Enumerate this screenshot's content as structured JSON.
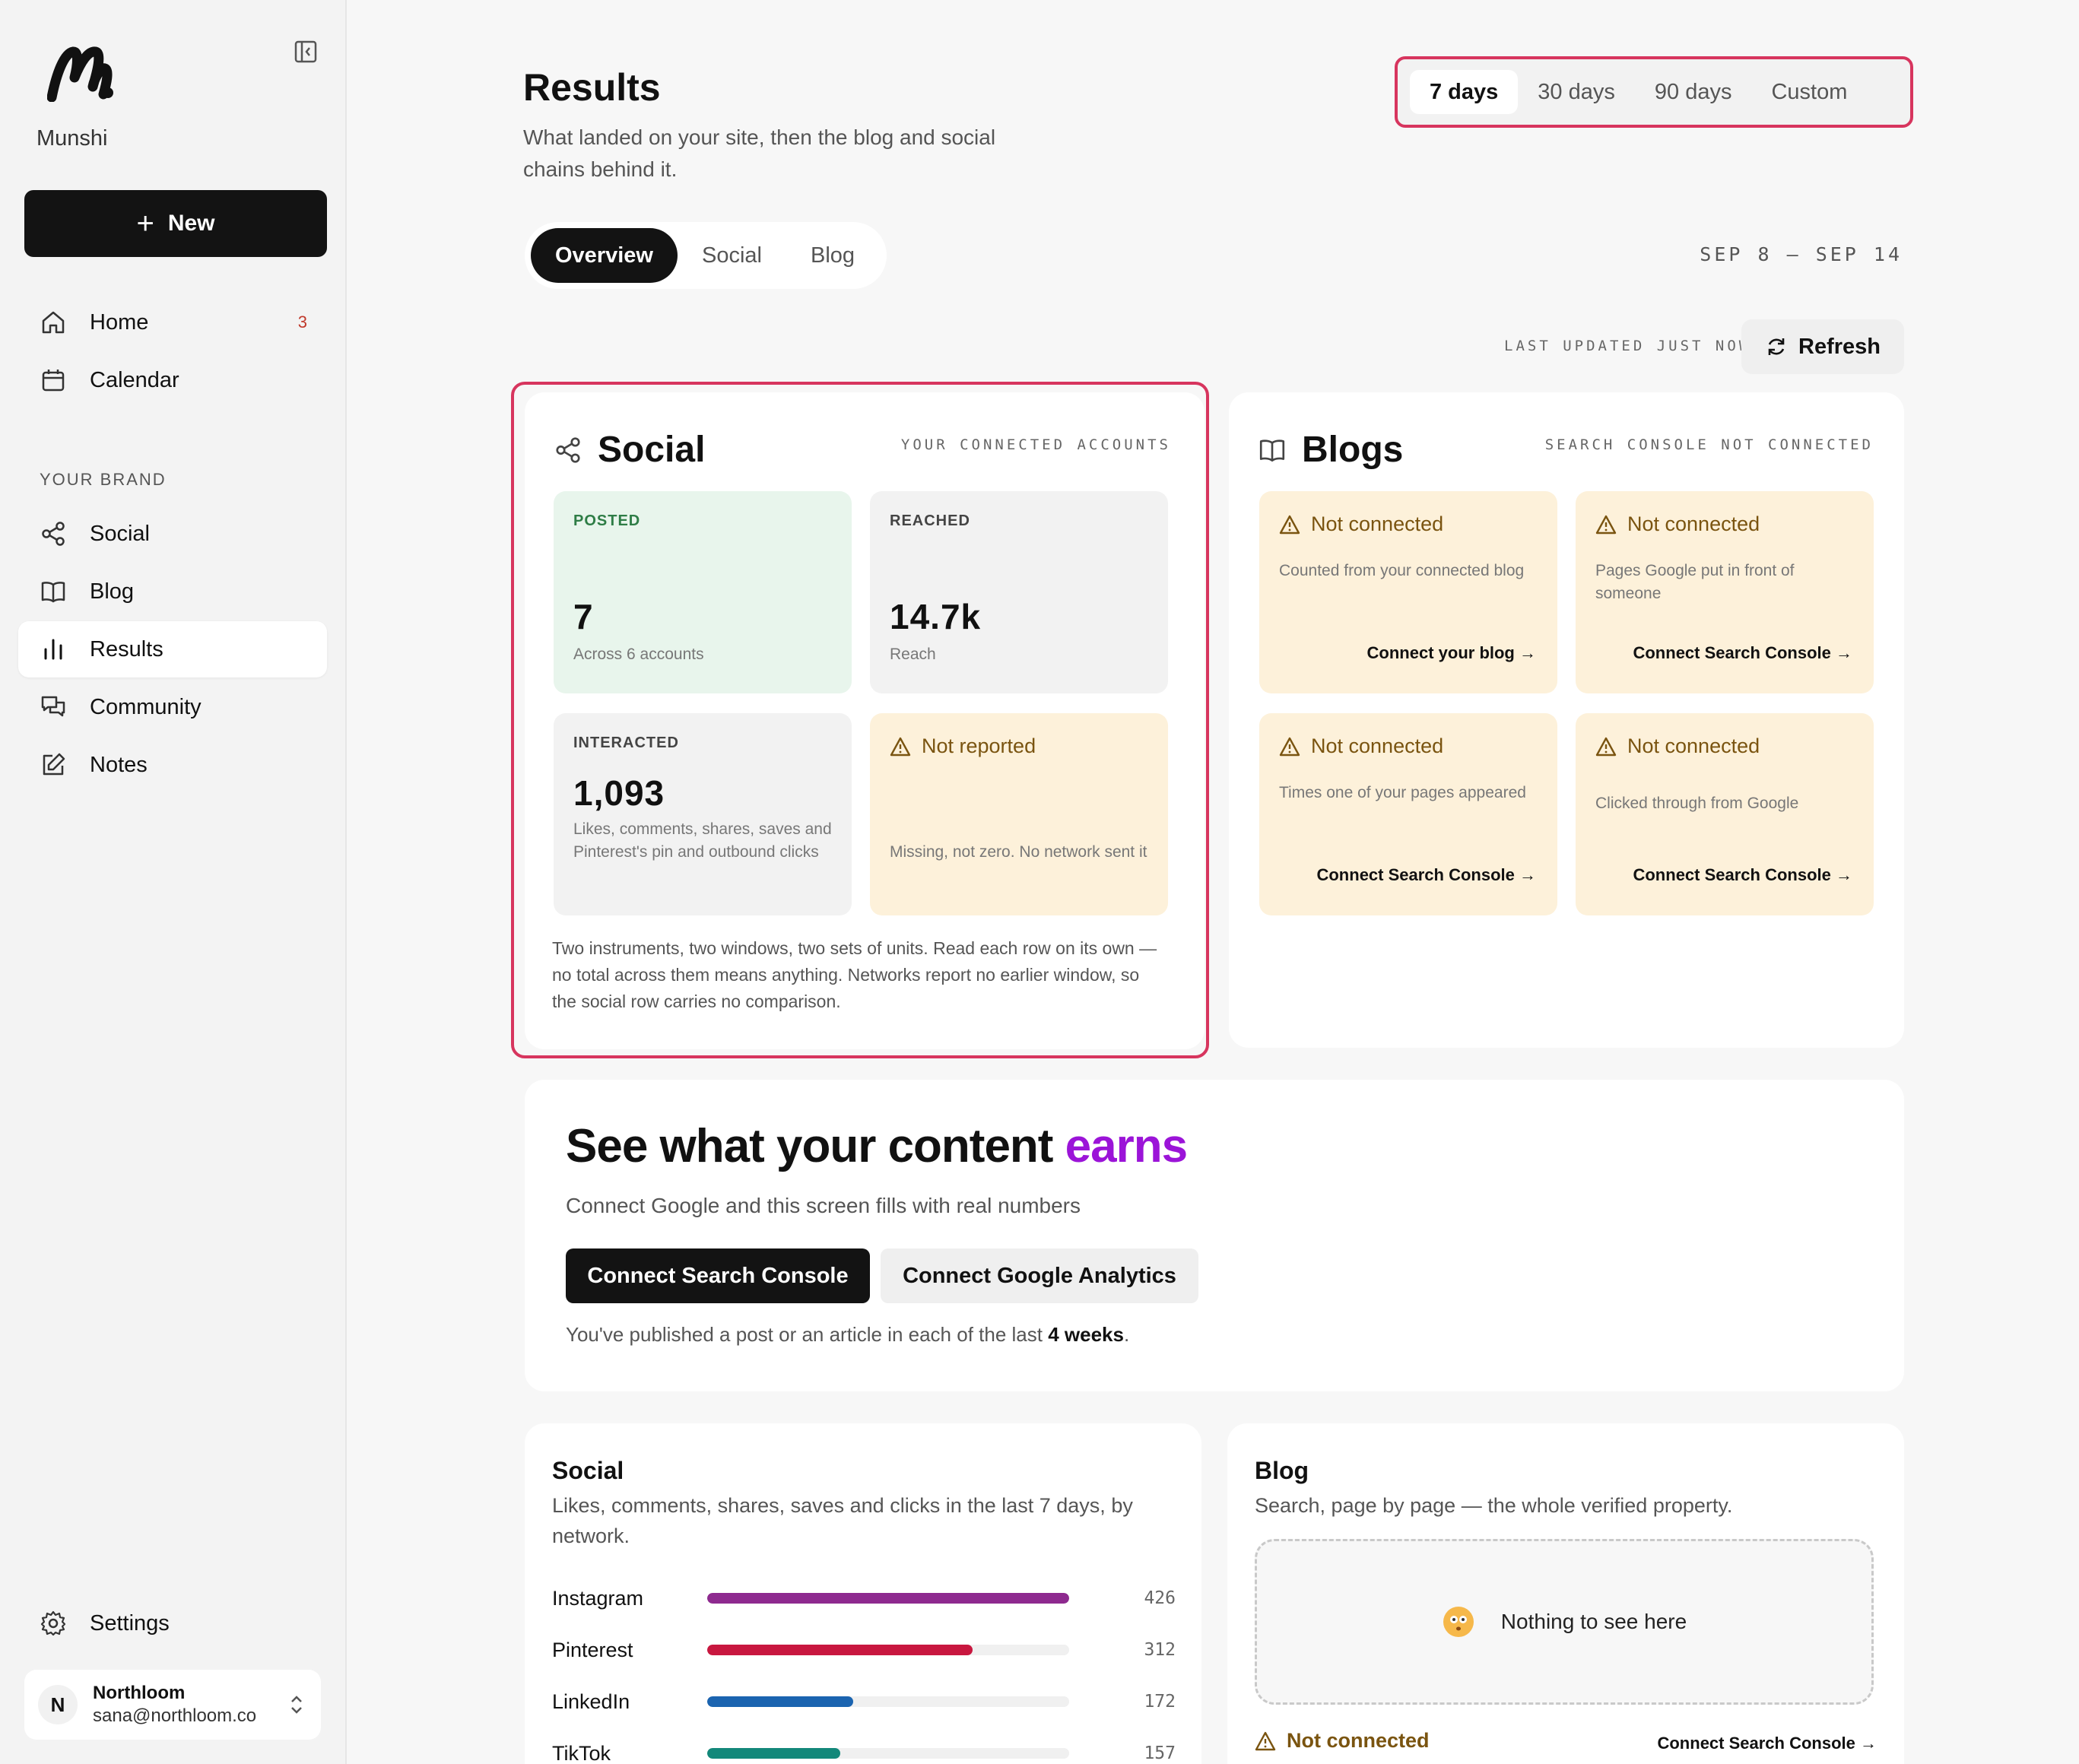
{
  "sidebar": {
    "brand": "Munshi",
    "new_label": "New",
    "nav": [
      {
        "label": "Home",
        "badge": "3"
      },
      {
        "label": "Calendar"
      }
    ],
    "section_label": "YOUR BRAND",
    "brand_nav": [
      {
        "label": "Social"
      },
      {
        "label": "Blog"
      },
      {
        "label": "Results",
        "active": true
      },
      {
        "label": "Community"
      },
      {
        "label": "Notes"
      }
    ],
    "settings_label": "Settings",
    "account": {
      "initial": "N",
      "name": "Northloom",
      "email": "sana@northloom.co"
    }
  },
  "header": {
    "title": "Results",
    "subtitle": "What landed on your site, then the blog and social chains behind it.",
    "ranges": [
      "7 days",
      "30 days",
      "90 days",
      "Custom"
    ],
    "active_range": "7 days",
    "tabs": [
      "Overview",
      "Social",
      "Blog"
    ],
    "active_tab": "Overview",
    "date_range": "SEP 8 – SEP 14",
    "updated": "LAST UPDATED JUST NOW",
    "refresh_label": "Refresh"
  },
  "social_card": {
    "title": "Social",
    "caption": "YOUR CONNECTED ACCOUNTS",
    "posted": {
      "label": "POSTED",
      "value": "7",
      "note": "Across 6 accounts"
    },
    "reached": {
      "label": "REACHED",
      "value": "14.7k",
      "note": "Reach"
    },
    "interacted": {
      "label": "INTERACTED",
      "value": "1,093",
      "note": "Likes, comments, shares, saves and Pinterest's pin and outbound clicks"
    },
    "not_reported": {
      "label": "Not reported",
      "note": "Missing, not zero. No network sent it"
    },
    "footnote": "Two instruments, two windows, two sets of units. Read each row on its own — no total across them means anything. Networks report no earlier window, so the social row carries no comparison."
  },
  "blogs_card": {
    "title": "Blogs",
    "caption": "SEARCH CONSOLE NOT CONNECTED",
    "tiles": [
      {
        "status": "Not connected",
        "note": "Counted from your connected blog",
        "cta": "Connect your blog →"
      },
      {
        "status": "Not connected",
        "note": "Pages Google put in front of someone",
        "cta": "Connect Search Console →"
      },
      {
        "status": "Not connected",
        "note": "Times one of your pages appeared",
        "cta": "Connect Search Console →"
      },
      {
        "status": "Not connected",
        "note": "Clicked through from Google",
        "cta": "Connect Search Console →"
      }
    ]
  },
  "promo": {
    "title_start": "See what your content ",
    "title_accent": "earns",
    "subtitle": "Connect Google and this screen fills with real numbers",
    "primary_button": "Connect Search Console",
    "secondary_button": "Connect Google Analytics",
    "foot_start": "You've published a post or an article in each of the last ",
    "foot_bold": "4 weeks",
    "foot_end": "."
  },
  "bottom_social": {
    "title": "Social",
    "subtitle": "Likes, comments, shares, saves and clicks in the last 7 days, by network.",
    "rows": [
      {
        "name": "Instagram",
        "value": 426,
        "color": "#8e2a8f"
      },
      {
        "name": "Pinterest",
        "value": 312,
        "color": "#c8173f"
      },
      {
        "name": "LinkedIn",
        "value": 172,
        "color": "#1b64b0"
      },
      {
        "name": "TikTok",
        "value": 157,
        "color": "#13887a"
      }
    ],
    "max_value": 426
  },
  "bottom_blog": {
    "title": "Blog",
    "subtitle": "Search, page by page — the whole verified property.",
    "empty_text": "Nothing to see here",
    "status": "Not connected",
    "cta": "Connect Search Console →"
  },
  "colors": {
    "accent_pink": "#d7355e",
    "accent_purple": "#9b14d8",
    "posted_green": "#e8f5ec",
    "amber": "#fdf1da"
  }
}
